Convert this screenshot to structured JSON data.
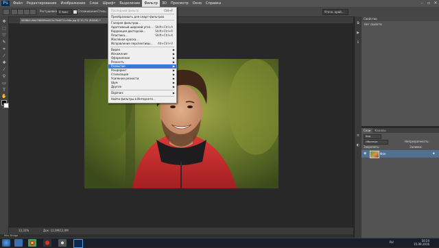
{
  "app": {
    "logo": "Ps"
  },
  "menubar": {
    "items": [
      "Файл",
      "Редактирование",
      "Изображение",
      "Слои",
      "Шрифт",
      "Выделение",
      "Фильтр",
      "3D",
      "Просмотр",
      "Окно",
      "Справка"
    ],
    "active_index": 6
  },
  "window_controls": {
    "minimize": "–",
    "restore": "▫",
    "close": "✕"
  },
  "options": {
    "feather_label": "Растушевка:",
    "feather_value": "0 пикс",
    "antialias_label": "Сглаживание",
    "style_label": "Стиль:",
    "style_value": "Обычный",
    "refine_label": "Уточн. край..."
  },
  "document": {
    "tab_title": "5698b1c6d4766f89dd023c79d6721c94b.jpg @ 33,7% (RGB/8) *",
    "zoom": "33,33%",
    "doc_info": "Док: 12,0М/12,0М"
  },
  "filter_menu": [
    {
      "label": "Последний фильтр",
      "shortcut": "Ctrl+F",
      "disabled": true
    },
    {
      "sep": true
    },
    {
      "label": "Преобразовать для смарт-фильтров"
    },
    {
      "sep": true
    },
    {
      "label": "Галерея фильтров..."
    },
    {
      "label": "Адаптивный широкий угол...",
      "shortcut": "Shift+Ctrl+A"
    },
    {
      "label": "Коррекция дисторсии...",
      "shortcut": "Shift+Ctrl+R"
    },
    {
      "label": "Пластика...",
      "shortcut": "Shift+Ctrl+X"
    },
    {
      "label": "Масляная краска..."
    },
    {
      "label": "Исправление перспективы...",
      "shortcut": "Alt+Ctrl+V"
    },
    {
      "sep": true
    },
    {
      "label": "Видео",
      "submenu": true
    },
    {
      "label": "Искажение",
      "submenu": true
    },
    {
      "label": "Оформление",
      "submenu": true
    },
    {
      "label": "Резкость",
      "submenu": true
    },
    {
      "label": "Размытие",
      "submenu": true,
      "highlighted": true
    },
    {
      "label": "Рендеринг",
      "submenu": true
    },
    {
      "label": "Стилизация",
      "submenu": true
    },
    {
      "label": "Усиление резкости",
      "submenu": true
    },
    {
      "label": "Шум",
      "submenu": true
    },
    {
      "label": "Другое",
      "submenu": true
    },
    {
      "sep": true
    },
    {
      "label": "Digimarc",
      "submenu": true
    },
    {
      "sep": true
    },
    {
      "label": "Найти фильтры в Интернете..."
    }
  ],
  "properties_panel": {
    "tab": "Свойства",
    "text": "Нет свойств"
  },
  "layers_panel": {
    "tabs": [
      "Слои",
      "Каналы"
    ],
    "kind_filter": "Вид",
    "blend_mode": "Обычные",
    "opacity_label": "Непрозрачность:",
    "lock_label": "Закрепить:",
    "fill_label": "Заливка:",
    "layer_name": "Фон"
  },
  "mini_bridge": {
    "label": "Mini Bridge"
  },
  "taskbar": {
    "lang": "RU",
    "time": "10:24",
    "date": "15.09.2016"
  },
  "colors": {
    "accent": "#3b78d8",
    "menubar": "#535353",
    "panel": "#535353",
    "canvas": "#282828",
    "jacket": "#c8262b"
  }
}
